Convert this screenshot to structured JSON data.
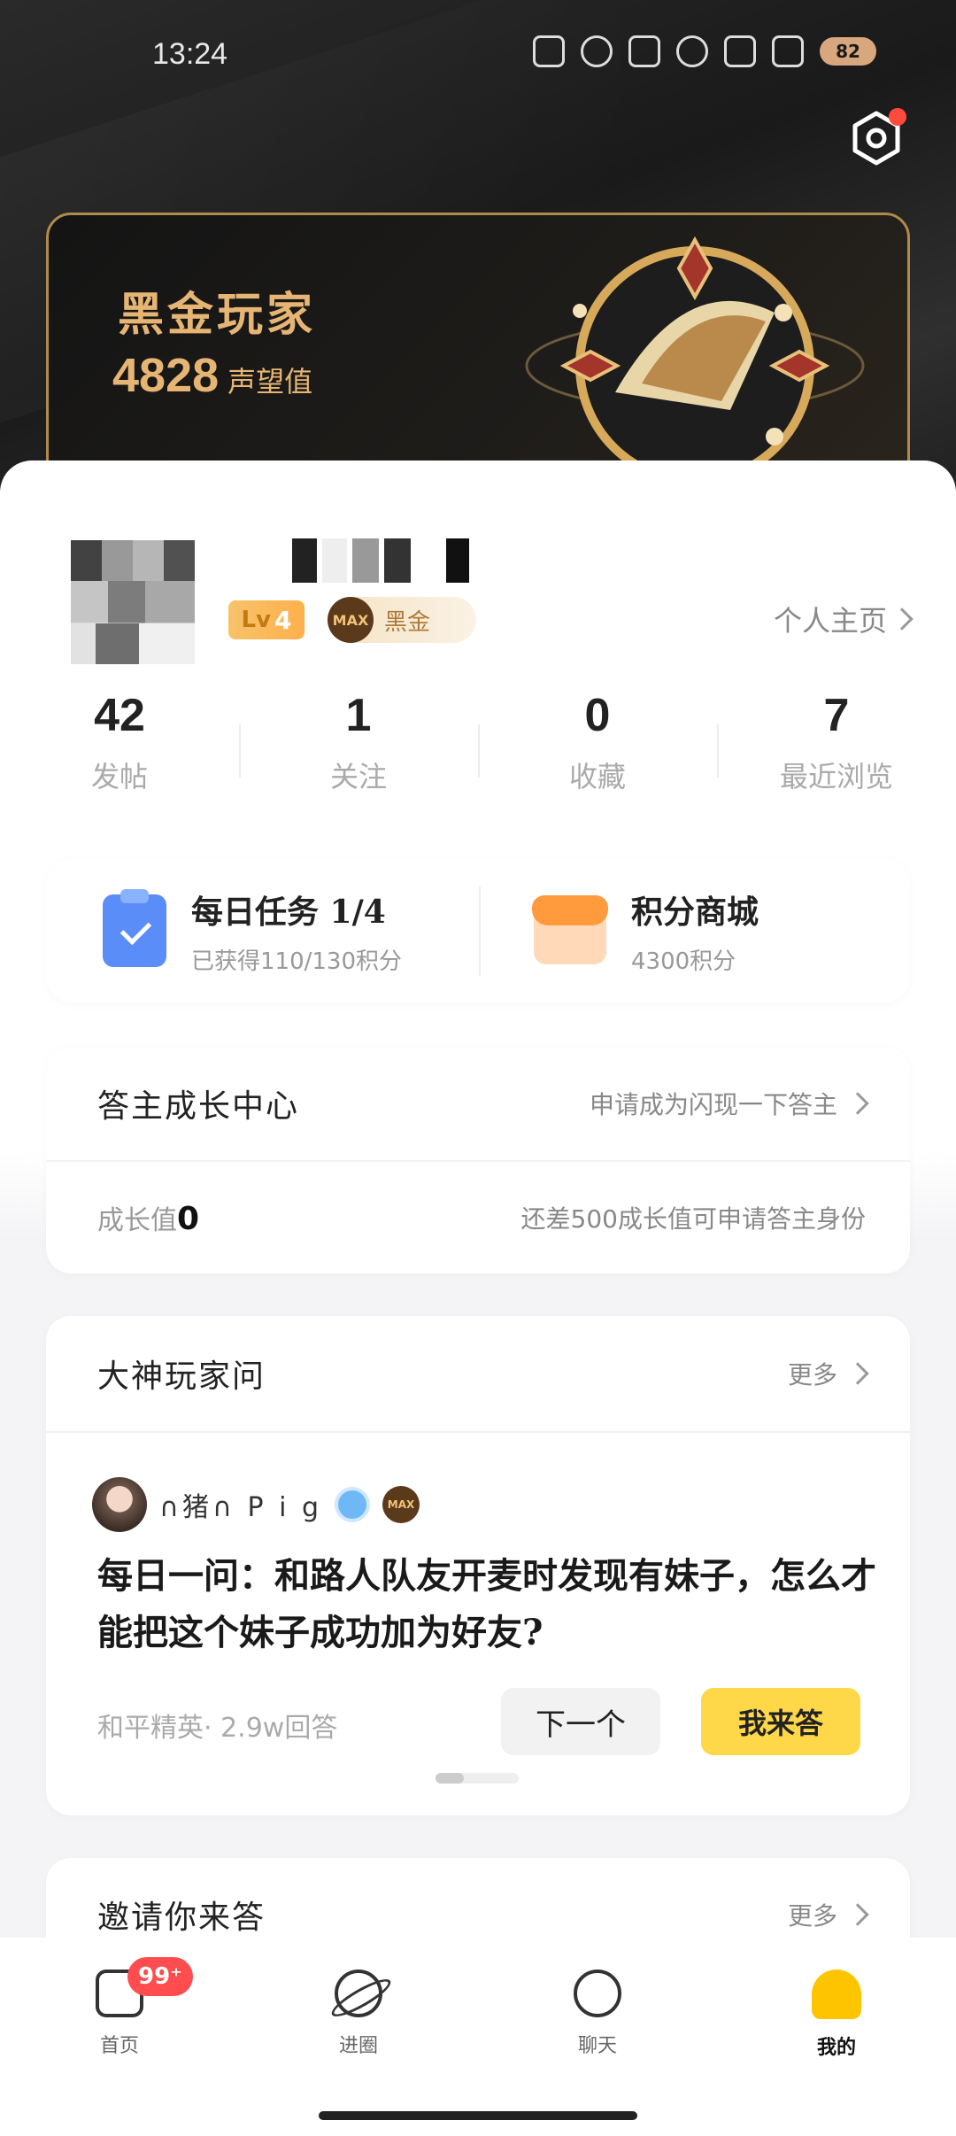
{
  "status_bar": {
    "time": "13:24",
    "battery": "82"
  },
  "gold_card": {
    "title": "黑金玩家",
    "reputation_value": "4828",
    "reputation_unit": "声望值"
  },
  "profile": {
    "level_badge": "4",
    "level_prefix": "Lv",
    "tier_badge_icon": "MAX",
    "tier_badge_label": "黑金",
    "homepage_link": "个人主页"
  },
  "stats": [
    {
      "value": "42",
      "label": "发帖"
    },
    {
      "value": "1",
      "label": "关注"
    },
    {
      "value": "0",
      "label": "收藏"
    },
    {
      "value": "7",
      "label": "最近浏览"
    }
  ],
  "tasks": {
    "daily": {
      "title": "每日任务 1/4",
      "subtitle": "已获得110/130积分"
    },
    "store": {
      "title": "积分商城",
      "subtitle": "4300积分"
    }
  },
  "growth": {
    "title": "答主成长中心",
    "apply_link": "申请成为闪现一下答主",
    "value_label": "成长值",
    "value": "0",
    "hint": "还差500成长值可申请答主身份"
  },
  "expert_ask": {
    "title": "大神玩家问",
    "more": "更多",
    "user_name": "∩猪∩ P i g",
    "user_badge2": "MAX",
    "question": "每日一问：和路人队友开麦时发现有妹子，怎么才能把这个妹子成功加为好友?",
    "meta": "和平精英· 2.9w回答",
    "next_button": "下一个",
    "answer_button": "我来答"
  },
  "invite": {
    "title": "邀请你来答",
    "more": "更多"
  },
  "bottom_nav": [
    {
      "label": "首页",
      "badge": "99⁺",
      "icon": "home-doc-icon"
    },
    {
      "label": "进圈",
      "icon": "planet-icon"
    },
    {
      "label": "聊天",
      "icon": "chat-bubble-icon"
    },
    {
      "label": "我的",
      "icon": "mine-duck-icon"
    }
  ],
  "colors": {
    "accent_gold": "#e6b574",
    "answer_button": "#ffd84a",
    "badge_red": "#ff4d4f"
  }
}
